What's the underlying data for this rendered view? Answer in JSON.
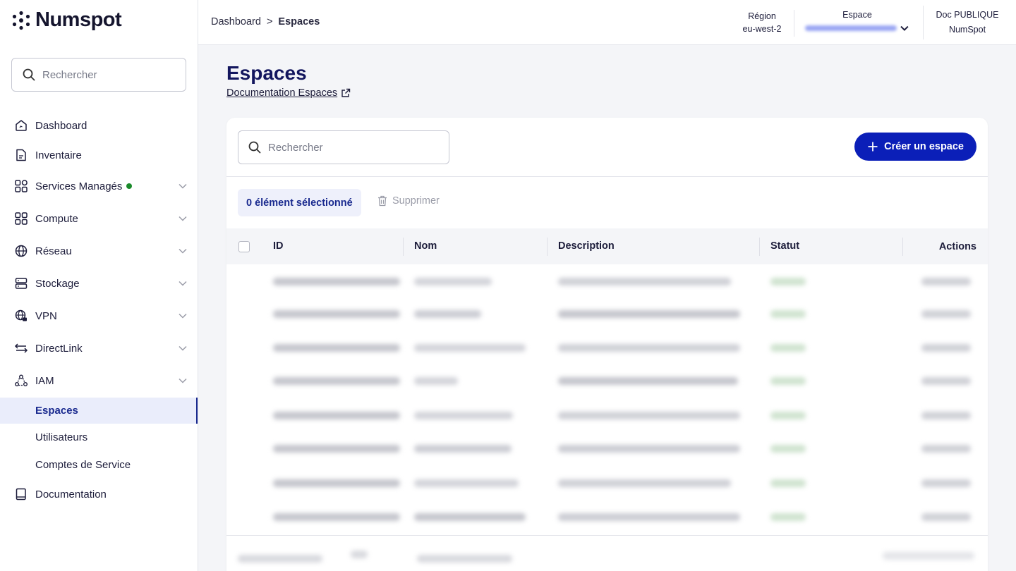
{
  "brand": {
    "name": "Numspot"
  },
  "sidebar": {
    "search_placeholder": "Rechercher",
    "items": [
      {
        "label": "Dashboard",
        "icon": "home-icon"
      },
      {
        "label": "Inventaire",
        "icon": "document-icon"
      },
      {
        "label": "Services Managés",
        "icon": "services-icon",
        "status_dot": true
      },
      {
        "label": "Compute",
        "icon": "grid-icon"
      },
      {
        "label": "Réseau",
        "icon": "globe-icon"
      },
      {
        "label": "Stockage",
        "icon": "storage-icon"
      },
      {
        "label": "VPN",
        "icon": "vpn-globe-icon"
      },
      {
        "label": "DirectLink",
        "icon": "arrows-icon"
      },
      {
        "label": "IAM",
        "icon": "users-icon"
      }
    ],
    "iam_children": [
      {
        "label": "Espaces",
        "active": true
      },
      {
        "label": "Utilisateurs"
      },
      {
        "label": "Comptes de Service"
      }
    ],
    "documentation": {
      "label": "Documentation",
      "icon": "book-icon"
    }
  },
  "header": {
    "breadcrumb": {
      "parent": "Dashboard",
      "separator": ">",
      "current": "Espaces"
    },
    "region": {
      "label": "Région",
      "value": "eu-west-2"
    },
    "space": {
      "label": "Espace"
    },
    "doc": {
      "label": "Doc PUBLIQUE",
      "value": "NumSpot"
    }
  },
  "main": {
    "title": "Espaces",
    "doc_link": "Documentation Espaces",
    "search_placeholder": "Rechercher",
    "create_button": "Créer un espace",
    "selection": "0 élément sélectionné",
    "delete_button": "Supprimer",
    "columns": [
      "ID",
      "Nom",
      "Description",
      "Statut",
      "Actions"
    ]
  },
  "colors": {
    "primary": "#0b1fb8",
    "title": "#13165e",
    "active_bg": "#eaedfb",
    "status_green": "#1a8a2a"
  }
}
